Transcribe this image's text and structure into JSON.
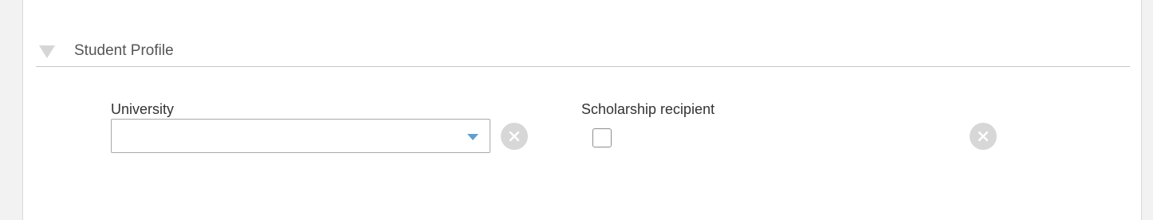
{
  "section": {
    "title": "Student Profile",
    "toggle_icon": "triangle-down-icon"
  },
  "fields": {
    "university": {
      "label": "University",
      "value": "",
      "control": "dropdown",
      "icons": [
        "chevron-down-icon",
        "clear-icon"
      ]
    },
    "scholarship": {
      "label": "Scholarship recipient",
      "checked": false,
      "control": "checkbox",
      "icons": [
        "clear-icon"
      ]
    }
  },
  "colors": {
    "accent": "#5b9fd3",
    "clear_button": "#d7d7d7",
    "divider": "#c8c8c8"
  }
}
